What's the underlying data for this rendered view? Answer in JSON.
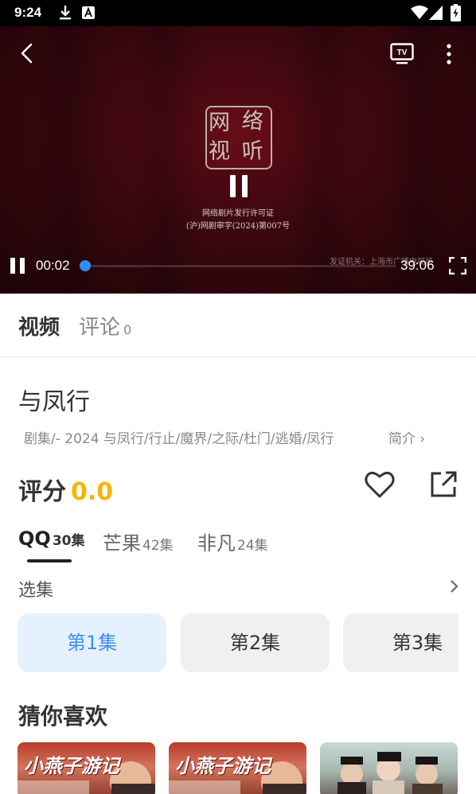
{
  "status_bar": {
    "time": "9:24"
  },
  "player": {
    "license_line1": "网络剧片发行许可证",
    "license_line2": "(沪)网剧审字(2024)第007号",
    "watermark": "发证机关：上海市广播电视局",
    "current_time": "00:02",
    "total_time": "39:06",
    "progress": 0.0009
  },
  "tabs": {
    "video": "视频",
    "comment": "评论",
    "comment_count": "0"
  },
  "show": {
    "title": "与凤行",
    "meta": "剧集/- 2024 与凤行/行止/魔界/之际/杜门/逃婚/凤行",
    "intro": "简介 ›"
  },
  "rating": {
    "label": "评分",
    "score": "0.0"
  },
  "sources": [
    {
      "name": "QQ",
      "count": "30集"
    },
    {
      "name": "芒果",
      "count": "42集"
    },
    {
      "name": "非凡",
      "count": "24集"
    }
  ],
  "episodes": {
    "label": "选集",
    "items": [
      "第1集",
      "第2集",
      "第3集"
    ]
  },
  "recommend": {
    "title": "猜你喜欢",
    "items": [
      "小燕子游记",
      "小燕子游记"
    ]
  },
  "colors": {
    "accent": "#3a8ef6",
    "score": "#f7b500",
    "player_bg": "#3a0710"
  }
}
